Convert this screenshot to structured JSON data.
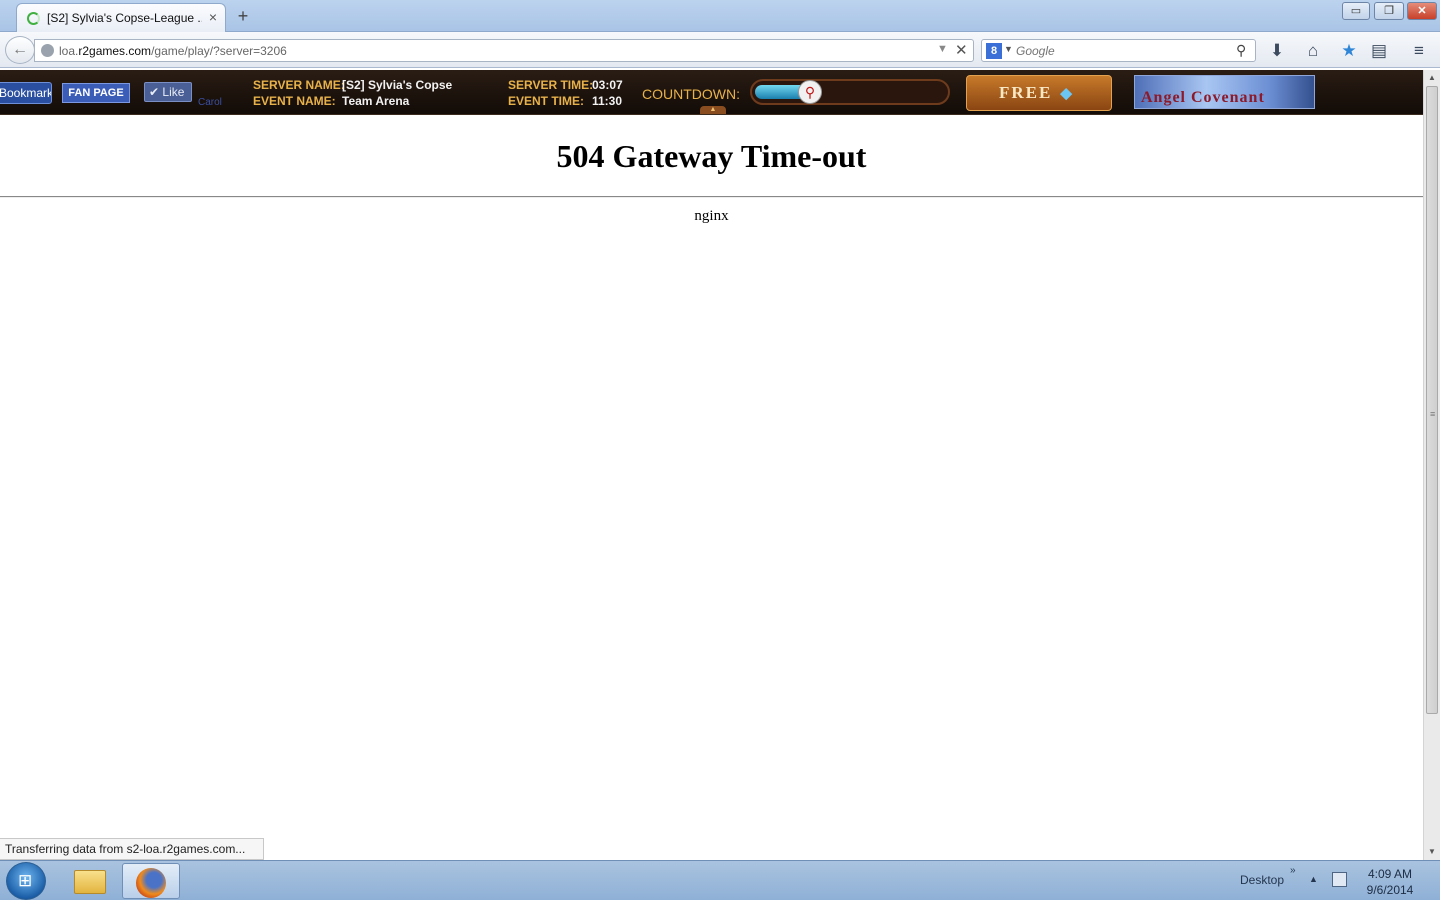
{
  "browser": {
    "tab": {
      "title": "[S2] Sylvia's Copse-League ...",
      "close": "×"
    },
    "new_tab": "+",
    "window_controls": {
      "minimize": "▭",
      "maximize": "❐",
      "close": "✕"
    },
    "back": "←",
    "url": {
      "prefix": "loa.",
      "domain": "r2games.com",
      "path": "/game/play/?server=3206"
    },
    "url_dropdown": "▼",
    "stop": "✕",
    "search": {
      "engine_icon": "8",
      "placeholder": "Google"
    },
    "icons": {
      "download": "arrow-down-icon",
      "home": "home-icon",
      "bookmark": "star-icon",
      "pocket": "reading-list-icon",
      "menu": "hamburger-menu-icon"
    }
  },
  "game_bar": {
    "bookmark_button": "Bookmark",
    "fan_page_button": "FAN PAGE",
    "like_button": "Like",
    "carol_text": "Carol",
    "server_name_label": "SERVER NAME:",
    "server_name_value": "[S2] Sylvia's Copse",
    "event_name_label": "EVENT NAME:",
    "event_name_value": "Team Arena",
    "server_time_label": "SERVER TIME:",
    "server_time_value": "03:07",
    "event_time_label": "EVENT TIME:",
    "event_time_value": "11:30",
    "countdown_label": "COUNTDOWN:",
    "countdown_progress": 0.3,
    "free_button": "FREE",
    "logo_text": "Angel Covenant"
  },
  "page": {
    "heading": "504 Gateway Time-out",
    "server_signature": "nginx"
  },
  "status_bar": "Transferring data from s2-loa.r2games.com...",
  "taskbar": {
    "desktop_label": "Desktop",
    "clock_time": "4:09 AM",
    "clock_date": "9/6/2014"
  },
  "colors": {
    "accent_gold": "#e8b24a",
    "game_bar_bg": "#1c120b",
    "facebook_blue": "#3b5db8"
  }
}
